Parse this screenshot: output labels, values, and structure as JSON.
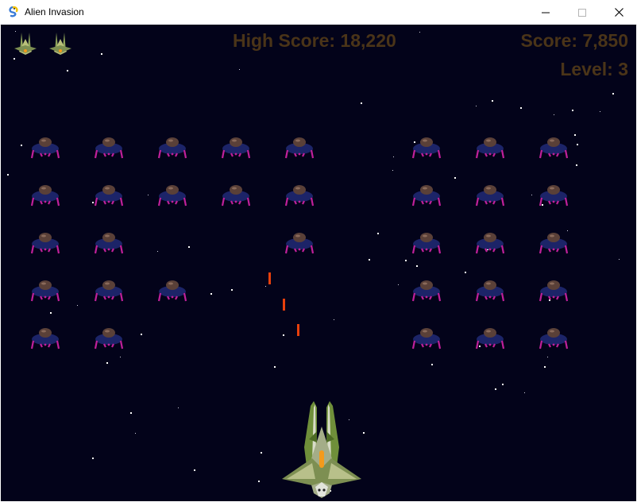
{
  "window": {
    "title": "Alien Invasion",
    "icon": "pygame-snake-icon",
    "controls": [
      "minimize-icon",
      "maximize-icon",
      "close-icon"
    ]
  },
  "hud": {
    "high_score": "High Score: 18,220",
    "score": "Score: 7,850",
    "level": "Level: 3",
    "lives_remaining": 2,
    "text_color": "#4a3418"
  },
  "game": {
    "background_color": "#03031a",
    "alien_colors": {
      "body": "#1c2468",
      "dome": "#5a4038",
      "legs": "#c0209a"
    },
    "bullet_color": "#e8400c",
    "alien_grid_columns": 9,
    "alien_grid_rows": 5,
    "aliens_present": [
      [
        true,
        true,
        true,
        true,
        true,
        false,
        true,
        true,
        true
      ],
      [
        true,
        true,
        true,
        true,
        true,
        false,
        true,
        true,
        true
      ],
      [
        true,
        true,
        false,
        false,
        true,
        false,
        true,
        true,
        true
      ],
      [
        true,
        true,
        true,
        false,
        false,
        false,
        true,
        true,
        true
      ],
      [
        true,
        true,
        false,
        false,
        false,
        false,
        true,
        true,
        true
      ]
    ],
    "bullets_in_flight": 3
  }
}
